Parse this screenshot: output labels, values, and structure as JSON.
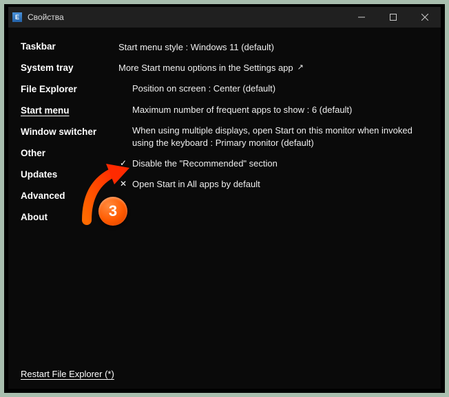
{
  "window": {
    "title": "Свойства"
  },
  "sidebar": {
    "items": [
      {
        "label": "Taskbar"
      },
      {
        "label": "System tray"
      },
      {
        "label": "File Explorer"
      },
      {
        "label": "Start menu"
      },
      {
        "label": "Window switcher"
      },
      {
        "label": "Other"
      },
      {
        "label": "Updates"
      },
      {
        "label": "Advanced"
      },
      {
        "label": "About"
      }
    ],
    "active_index": 3
  },
  "content": {
    "style_line": "Start menu style : Windows 11 (default)",
    "more_options": "More Start menu options in the Settings app",
    "position": "Position on screen : Center (default)",
    "max_apps": "Maximum number of frequent apps to show : 6 (default)",
    "multi_display": "When using multiple displays, open Start on this monitor when invoked using the keyboard : Primary monitor (default)",
    "disable_recommended": "Disable the \"Recommended\" section",
    "open_all_apps": "Open Start in All apps by default"
  },
  "footer": {
    "restart": "Restart File Explorer (*)"
  },
  "annotation": {
    "badge": "3"
  }
}
